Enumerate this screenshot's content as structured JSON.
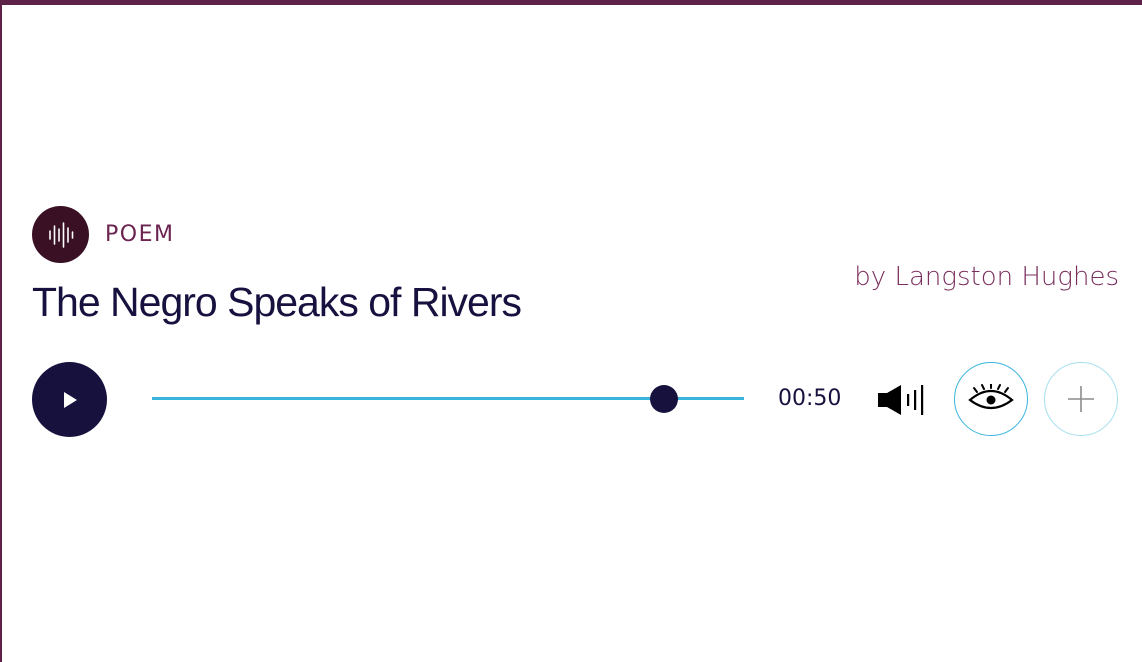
{
  "item": {
    "kind": "POEM",
    "kind_icon": "waveform-icon",
    "title": "The Negro Speaks of Rivers",
    "author": "by Langston Hughes"
  },
  "player": {
    "time": "00:50",
    "progress_fraction": 0.865,
    "play_icon": "play-icon",
    "volume_icon": "volume-icon",
    "text_toggle_icon": "eye-icon",
    "add_icon": "plus-icon"
  },
  "colors": {
    "frame": "#5e2147",
    "badge": "#3a1024",
    "kind_text": "#6b2350",
    "title_text": "#16113f",
    "author_text": "#7a2e5c",
    "accent": "#3bb4dd",
    "dark": "#17123d"
  }
}
